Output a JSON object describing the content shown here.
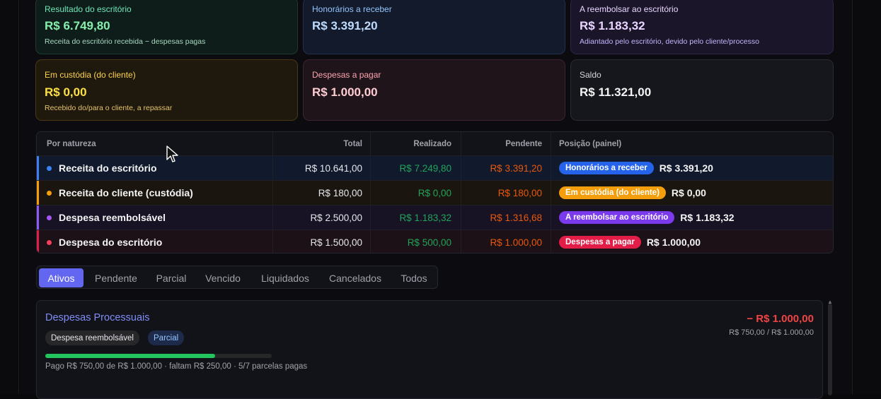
{
  "cards": {
    "resultado": {
      "label": "Resultado do escritório",
      "value": "R$ 6.749,80",
      "sub": "Receita do escritório recebida − despesas pagas"
    },
    "honorarios": {
      "label": "Honorários a receber",
      "value": "R$ 3.391,20"
    },
    "reembolsar": {
      "label": "A reembolsar ao escritório",
      "value": "R$ 1.183,32",
      "sub": "Adiantado pelo escritório, devido pelo cliente/processo"
    },
    "custodia": {
      "label": "Em custódia (do cliente)",
      "value": "R$ 0,00",
      "sub": "Recebido do/para o cliente, a repassar"
    },
    "despesas": {
      "label": "Despesas a pagar",
      "value": "R$ 1.000,00"
    },
    "saldo": {
      "label": "Saldo",
      "value": "R$ 11.321,00"
    }
  },
  "table": {
    "headers": [
      "Por natureza",
      "Total",
      "Realizado",
      "Pendente",
      "Posição (painel)"
    ],
    "rows": [
      {
        "natureza": "Receita do escritório",
        "total": "R$ 10.641,00",
        "realizado": "R$ 7.249,80",
        "pendente": "R$ 3.391,20",
        "badge": "Honorários a receber",
        "posicao": "R$ 3.391,20",
        "color": "#3b82f6"
      },
      {
        "natureza": "Receita do cliente (custódia)",
        "total": "R$ 180,00",
        "realizado": "R$ 0,00",
        "pendente": "R$ 180,00",
        "badge": "Em custódia (do cliente)",
        "posicao": "R$ 0,00",
        "color": "#f59e0b"
      },
      {
        "natureza": "Despesa reembolsável",
        "total": "R$ 2.500,00",
        "realizado": "R$ 1.183,32",
        "pendente": "R$ 1.316,68",
        "badge": "A reembolsar ao escritório",
        "posicao": "R$ 1.183,32",
        "color": "#8b5cf6"
      },
      {
        "natureza": "Despesa do escritório",
        "total": "R$ 1.500,00",
        "realizado": "R$ 500,00",
        "pendente": "R$ 1.000,00",
        "badge": "Despesas a pagar",
        "posicao": "R$ 1.000,00",
        "color": "#e11d48"
      }
    ]
  },
  "tabs": [
    "Ativos",
    "Pendente",
    "Parcial",
    "Vencido",
    "Liquidados",
    "Cancelados",
    "Todos"
  ],
  "active_tab": "Ativos",
  "item": {
    "title": "Despesas Processuais",
    "type_chip": "Despesa reembolsável",
    "status_chip": "Parcial",
    "progress_fraction": 0.75,
    "paid_text": "Pago R$ 750,00 de R$ 1.000,00 · faltam R$ 250,00 · 5/7 parcelas pagas",
    "amount": "− R$ 1.000,00",
    "amount_sub": "R$ 750,00 / R$ 1.000,00"
  },
  "colors": {
    "accent": "#6366f1",
    "realized": "#22a35a",
    "pending": "#ea580c"
  }
}
